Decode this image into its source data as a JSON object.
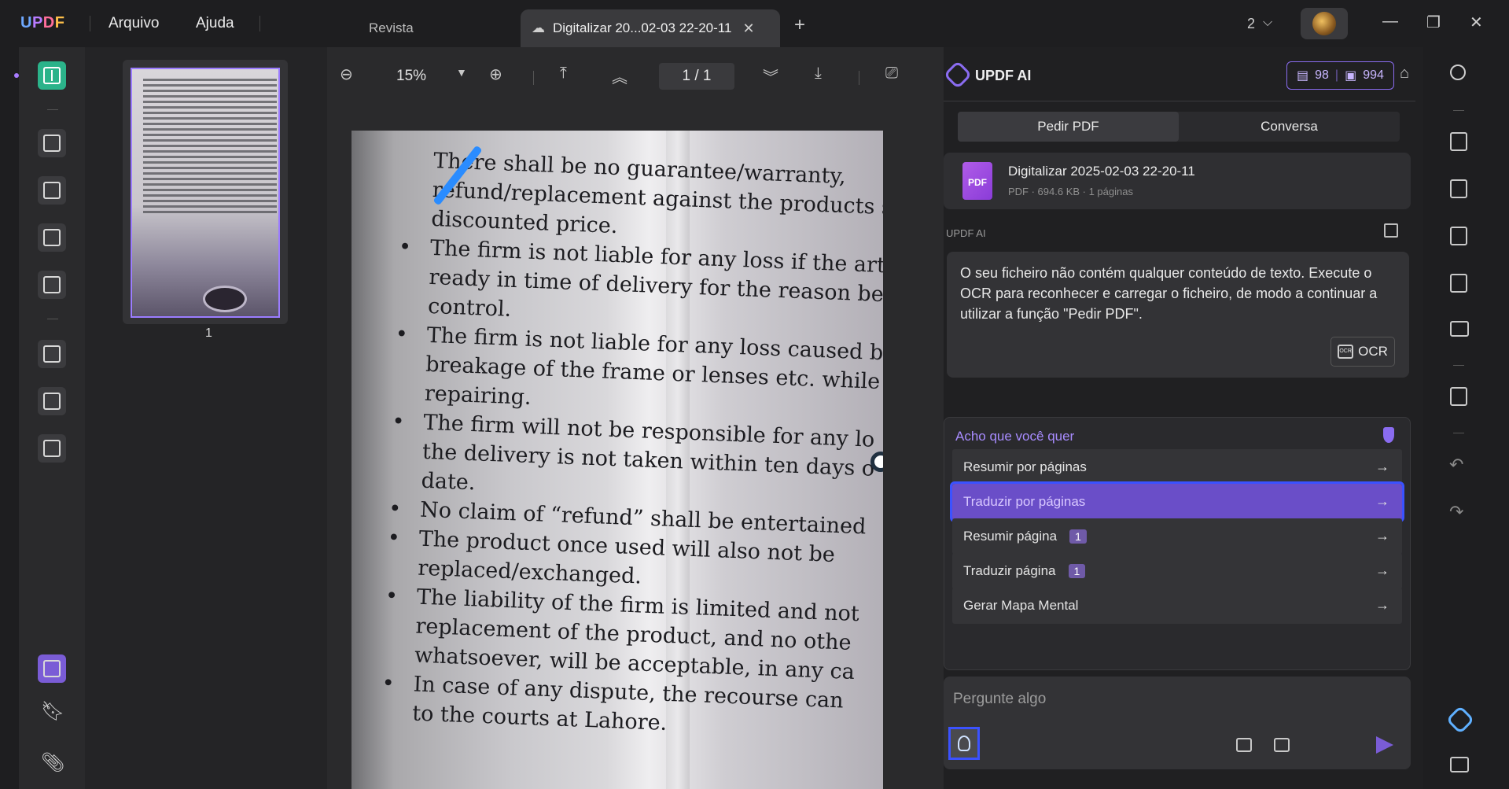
{
  "app": {
    "logo": "UPDF"
  },
  "menu": {
    "file": "Arquivo",
    "help": "Ajuda"
  },
  "tabs": [
    {
      "label": "Revista"
    },
    {
      "label": "Digitalizar 20...02-03 22-20-11"
    }
  ],
  "window": {
    "count": "2",
    "new_tab": "+"
  },
  "viewer": {
    "zoom": "15%",
    "page_current": "1",
    "page_sep": "/",
    "page_total": "1",
    "thumbnail_label": "1",
    "document_lines": [
      "There shall be no guarantee/warranty,",
      "refund/replacement against the products so",
      "discounted price.",
      "The firm is not liable for any loss if the artic",
      "ready in time of delivery for the reason bey",
      "control.",
      "The firm is not liable for any loss caused by",
      "breakage of the frame or lenses etc. while",
      "repairing.",
      "The firm will not be responsible for any lo",
      "the delivery is not taken within ten days o",
      "date.",
      "No claim of “refund” shall be entertained",
      "The product once used will also not be",
      "replaced/exchanged.",
      "The liability of the firm is limited and not",
      "replacement of the product, and no othe",
      "whatsoever, will be acceptable, in any ca",
      "In case of any dispute, the recourse can",
      "to the courts at Lahore."
    ]
  },
  "ai": {
    "title": "UPDF AI",
    "credits_docs": "98",
    "credits_chat": "994",
    "tab_ask_pdf": "Pedir PDF",
    "tab_chat": "Conversa",
    "file_name": "Digitalizar 2025-02-03 22-20-11",
    "file_meta": "PDF · 694.6 KB · 1 páginas",
    "file_icon_text": "PDF",
    "section_label": "UPDF AI",
    "message": "O seu ficheiro não contém qualquer conteúdo de texto. Execute o OCR para reconhecer e carregar o ficheiro, de modo a continuar a utilizar a função \"Pedir PDF\".",
    "ocr_button": "OCR",
    "ocr_mini": "OCR",
    "suggest_title": "Acho que você quer",
    "suggestions": [
      {
        "label": "Resumir por páginas",
        "badge": ""
      },
      {
        "label": "Traduzir por páginas",
        "badge": ""
      },
      {
        "label": "Resumir página",
        "badge": "1"
      },
      {
        "label": "Traduzir página",
        "badge": "1"
      },
      {
        "label": "Gerar Mapa Mental",
        "badge": ""
      }
    ],
    "input_placeholder": "Pergunte algo"
  }
}
